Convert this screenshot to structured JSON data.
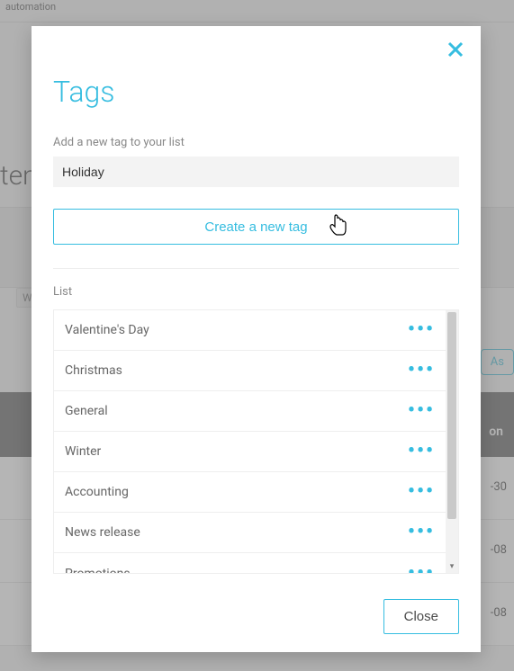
{
  "background": {
    "breadcrumb": "automation",
    "truncated_heading": "tem",
    "pill": "Wa",
    "assign_btn": "As",
    "col_suffix": "on",
    "rows": [
      "-30",
      "-08",
      "-08"
    ]
  },
  "modal": {
    "title": "Tags",
    "add_label": "Add a new tag to your list",
    "input_value": "Holiday",
    "create_label": "Create a new tag",
    "list_label": "List",
    "tags": [
      "Valentine's Day",
      "Christmas",
      "General",
      "Winter",
      "Accounting",
      "News release",
      "Promotions"
    ],
    "close_label": "Close"
  }
}
